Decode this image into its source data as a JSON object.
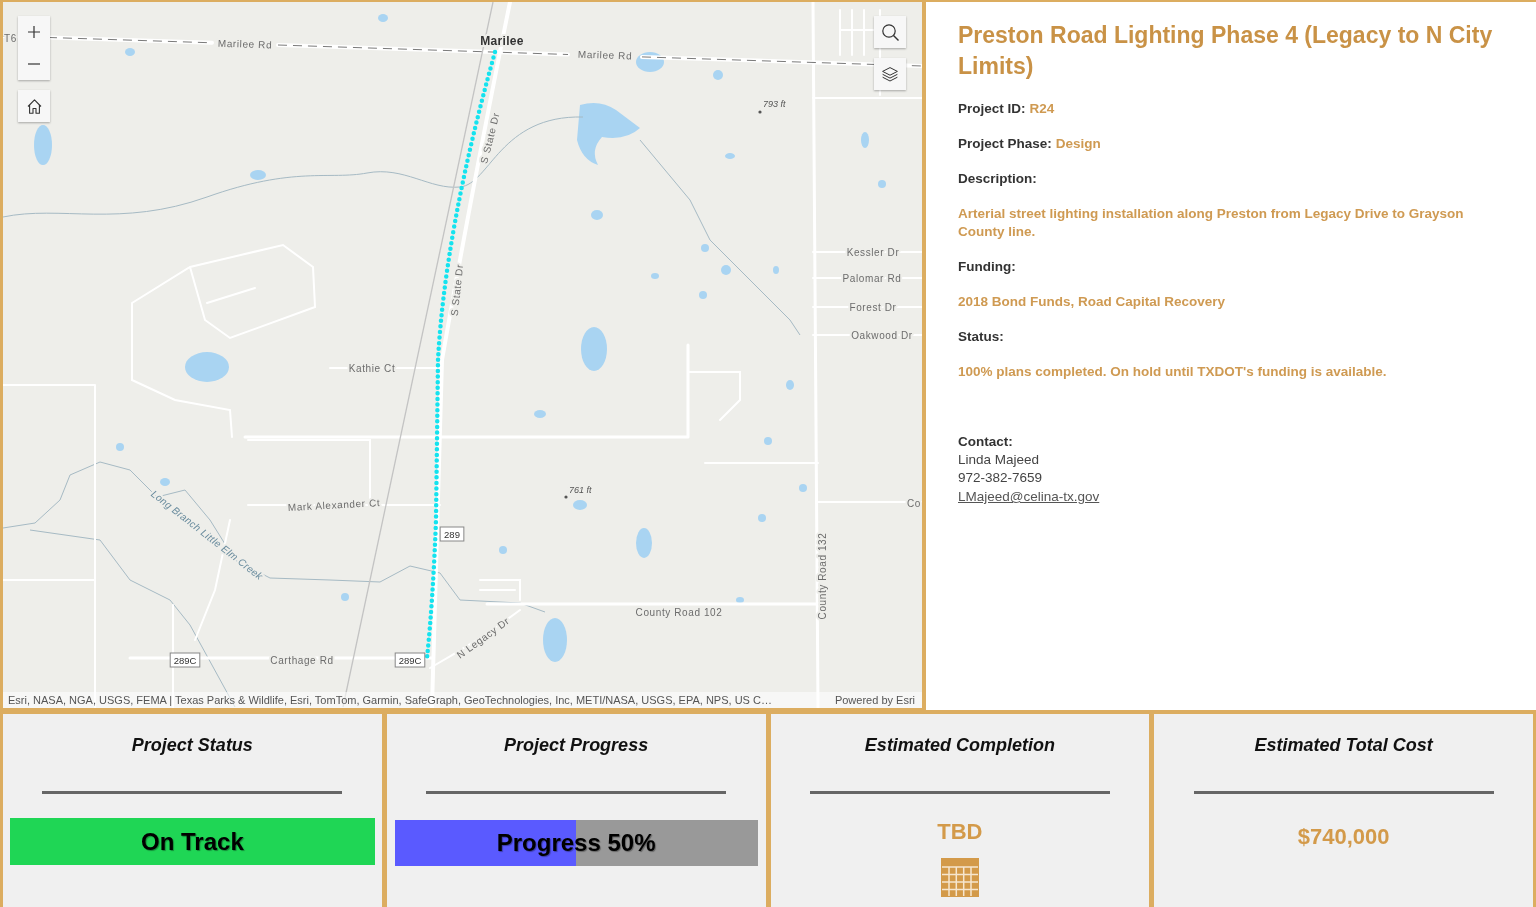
{
  "map": {
    "labels": [
      {
        "text": "T6",
        "kind": "road"
      },
      {
        "text": "Marilee Rd",
        "kind": "road"
      },
      {
        "text": "Marilee",
        "kind": "place"
      },
      {
        "text": "Marilee Rd",
        "kind": "road"
      },
      {
        "text": "793 ft",
        "kind": "elevation"
      },
      {
        "text": "S State Dr",
        "kind": "road"
      },
      {
        "text": "Kessler Dr",
        "kind": "road"
      },
      {
        "text": "Palomar Rd",
        "kind": "road"
      },
      {
        "text": "S State Dr",
        "kind": "road"
      },
      {
        "text": "Forest Dr",
        "kind": "road"
      },
      {
        "text": "Oakwood Dr",
        "kind": "road"
      },
      {
        "text": "Kathie Ct",
        "kind": "road"
      },
      {
        "text": "761 ft",
        "kind": "elevation"
      },
      {
        "text": "Mark Alexander Ct",
        "kind": "road"
      },
      {
        "text": "Long Branch Little Elm Creek",
        "kind": "water"
      },
      {
        "text": "Co",
        "kind": "road"
      },
      {
        "text": "289",
        "kind": "shield"
      },
      {
        "text": "County Road 132",
        "kind": "road"
      },
      {
        "text": "County Road 102",
        "kind": "road"
      },
      {
        "text": "N Legacy Dr",
        "kind": "road"
      },
      {
        "text": "289C",
        "kind": "shield"
      },
      {
        "text": "Carthage Rd",
        "kind": "road"
      },
      {
        "text": "289C",
        "kind": "shield"
      }
    ],
    "attribution": "Esri, NASA, NGA, USGS, FEMA | Texas Parks & Wildlife, Esri, TomTom, Garmin, SafeGraph, GeoTechnologies, Inc, METI/NASA, USGS, EPA, NPS, US C…",
    "powered_by": "Powered by Esri"
  },
  "details": {
    "title": "Preston Road Lighting Phase 4 (Legacy to N City Limits)",
    "fields": [
      {
        "label": "Project ID:",
        "value": "R24",
        "kind": "inline"
      },
      {
        "label": "Project Phase:",
        "value": "Design",
        "kind": "inline"
      },
      {
        "label": "Description:",
        "value": "Arterial street lighting installation along Preston from Legacy Drive to Grayson County line.",
        "kind": "block"
      },
      {
        "label": "Funding:",
        "value": "2018 Bond Funds, Road Capital Recovery",
        "kind": "block"
      },
      {
        "label": "Status:",
        "value": "100% plans completed. On hold until TXDOT's funding is available.",
        "kind": "block"
      }
    ],
    "contact": {
      "label": "Contact:",
      "name": "Linda Majeed",
      "phone": "972-382-7659",
      "email": "LMajeed@celina-tx.gov"
    }
  },
  "cards": [
    {
      "title": "Project Status",
      "kind": "status",
      "value": "On Track",
      "color": "#1fd655"
    },
    {
      "title": "Project Progress",
      "kind": "progress",
      "value": "Progress 50%",
      "level": 0.5
    },
    {
      "title": "Estimated Completion",
      "kind": "date",
      "value": "TBD"
    },
    {
      "title": "Estimated Total Cost",
      "kind": "amount",
      "value": "$740,000"
    }
  ]
}
